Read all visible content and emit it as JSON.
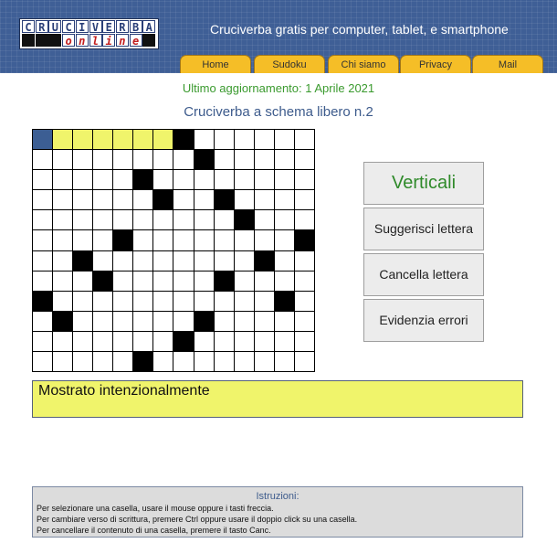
{
  "header": {
    "logo_top": [
      "C",
      "R",
      "U",
      "C",
      "I",
      "V",
      "E",
      "R",
      "B",
      "A"
    ],
    "logo_bottom": [
      "o",
      "n",
      "l",
      "i",
      "n",
      "e"
    ],
    "tagline": "Cruciverba gratis per computer, tablet, e smartphone"
  },
  "nav": {
    "items": [
      "Home",
      "Sudoku",
      "Chi siamo",
      "Privacy",
      "Mail"
    ]
  },
  "update": "Ultimo aggiornamento: 1 Aprile 2021",
  "puzzle_title": "Cruciverba a schema libero n.2",
  "grid": {
    "cols": 14,
    "rows": 12,
    "black_cells": [
      [
        0,
        7
      ],
      [
        1,
        8
      ],
      [
        2,
        5
      ],
      [
        3,
        6
      ],
      [
        3,
        9
      ],
      [
        4,
        10
      ],
      [
        5,
        4
      ],
      [
        5,
        13
      ],
      [
        6,
        2
      ],
      [
        6,
        11
      ],
      [
        7,
        3
      ],
      [
        7,
        9
      ],
      [
        8,
        0
      ],
      [
        8,
        12
      ],
      [
        9,
        1
      ],
      [
        9,
        8
      ],
      [
        10,
        7
      ],
      [
        11,
        5
      ]
    ],
    "highlighted_cells": [
      [
        0,
        1
      ],
      [
        0,
        2
      ],
      [
        0,
        3
      ],
      [
        0,
        4
      ],
      [
        0,
        5
      ],
      [
        0,
        6
      ]
    ],
    "selected_cell": [
      0,
      0
    ],
    "colors": {
      "highlight": "#f0f46b",
      "selected": "#3c5e93",
      "black": "#000000"
    }
  },
  "buttons": {
    "direction": "Verticali",
    "suggest": "Suggerisci lettera",
    "clear": "Cancella lettera",
    "errors": "Evidenzia errori"
  },
  "hint_box": "Mostrato intenzionalmente",
  "instructions": {
    "title": "Istruzioni:",
    "lines": [
      "Per selezionare una casella, usare il mouse oppure i tasti freccia.",
      "Per cambiare verso di scrittura, premere Ctrl oppure usare il doppio click su una casella.",
      "Per cancellare il contenuto di una casella, premere il tasto Canc."
    ]
  }
}
